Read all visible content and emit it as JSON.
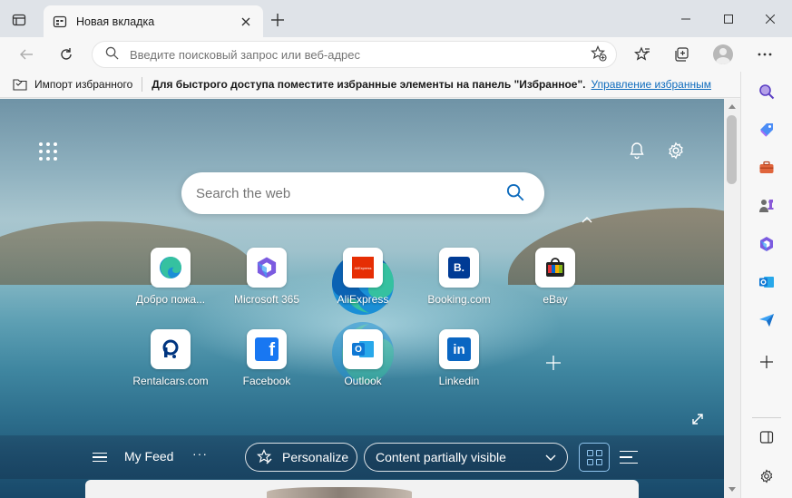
{
  "tab": {
    "title": "Новая вкладка"
  },
  "addressbar": {
    "placeholder": "Введите поисковый запрос или веб-адрес"
  },
  "favorites_bar": {
    "import_label": "Импорт избранного",
    "hint": "Для быстрого доступа поместите избранные элементы на панель \"Избранное\".",
    "manage_link": "Управление избранным"
  },
  "ntp": {
    "search_placeholder": "Search the web",
    "tiles": [
      {
        "label": "Добро пожа...",
        "icon": "edge-icon"
      },
      {
        "label": "Microsoft 365",
        "icon": "microsoft-365-icon"
      },
      {
        "label": "AliExpress",
        "icon": "aliexpress-icon",
        "icon_text": "AliExpress"
      },
      {
        "label": "Booking.com",
        "icon": "booking-icon",
        "icon_text": "B."
      },
      {
        "label": "eBay",
        "icon": "ebay-icon"
      },
      {
        "label": "Rentalcars.com",
        "icon": "rentalcars-icon"
      },
      {
        "label": "Facebook",
        "icon": "facebook-icon",
        "icon_text": "f"
      },
      {
        "label": "Outlook",
        "icon": "outlook-icon",
        "icon_text": "O"
      },
      {
        "label": "Linkedin",
        "icon": "linkedin-icon",
        "icon_text": "in"
      }
    ],
    "feed": {
      "title": "My Feed",
      "more": "···",
      "personalize": "Personalize",
      "content_visibility": "Content partially visible"
    }
  },
  "colors": {
    "accent_link": "#0f6cbd",
    "booking": "#003b95",
    "facebook": "#1877f2",
    "linkedin": "#0a66c2",
    "outlook": "#0f78d4",
    "aliexpress": "#e62e04"
  }
}
